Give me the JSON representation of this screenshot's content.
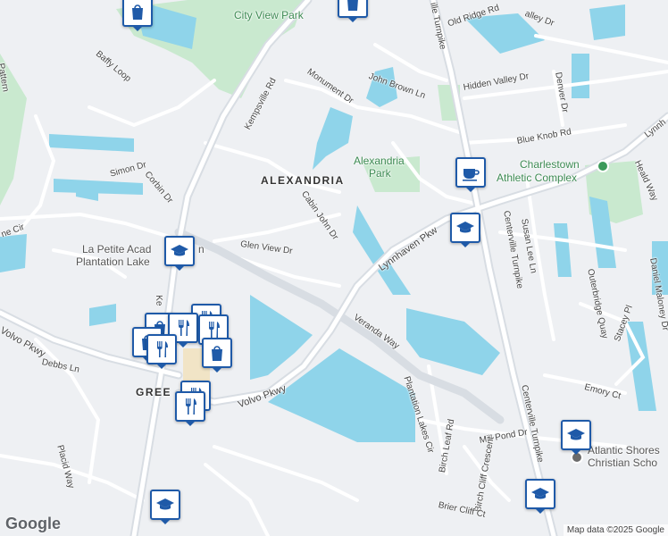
{
  "map": {
    "attribution": "Map data ©2025 Google",
    "logo": "Google"
  },
  "areas": {
    "alexandria": "ALEXANDRIA",
    "greenbriar_line1": "GREE",
    "greenbriar_line2": "EA"
  },
  "parks": {
    "city_view_park": "City View Park",
    "alexandria_park_line1": "Alexandria",
    "alexandria_park_line2": "Park"
  },
  "places": {
    "la_petite_line1": "La Petite Acad",
    "la_petite_line1b": "n",
    "la_petite_line2": "Plantation Lake",
    "charlestown_line1": "Charlestown",
    "charlestown_line2": "Athletic Complex",
    "atlantic_shores_line1": "Atlantic Shores",
    "atlantic_shores_line2": "Christian Scho"
  },
  "streets": {
    "kempsville_rd": "Kempsville Rd",
    "kempsville_partial": "Ke",
    "centerville_tpke_top": "ille Turnpike",
    "centerville_tpke_1": "Centerville Turnpike",
    "centerville_tpke_2": "Centerville Turnpike",
    "old_ridge_rd": "Old Ridge Rd",
    "valley_dr": "alley Dr",
    "john_brown_ln": "John Brown Ln",
    "hidden_valley_dr": "Hidden Valley Dr",
    "monument_dr": "Monument Dr",
    "denver_dr": "Denver Dr",
    "blue_knob_rd": "Blue Knob Rd",
    "lynnhaven_top": "Lynnh",
    "heald_way": "Heald Way",
    "baffy_loop": "Baffy Loop",
    "simon_dr": "Simon Dr",
    "corbin_dr": "Corbin Dr",
    "cabin_john_dr": "Cabin John Dr",
    "glen_view_dr": "Glen View Dr",
    "lynnhaven_pkwy": "Lynnhaven Pkw",
    "susan_lee_ln": "Susan Lee Ln",
    "daniel_maloney_dr": "Daniel Maloney Dr",
    "outerbridge_quay": "Outerbridge Quay",
    "stacey_pl": "Stacey Pl",
    "emory_ct": "Emory Ct",
    "volvo_pkwy_left": "Volvo Pkwy",
    "volvo_pkwy_mid": "Volvo Pkwy",
    "veranda_way": "Veranda Way",
    "plantation_lakes_cir": "Plantation Lakes Cir",
    "birch_leaf_rd": "Birch Leaf Rd",
    "mill_pond_dr": "Mill Pond Dr",
    "birch_cliff_crescent": "Birch Cliff Crescent",
    "brier_cliff_ct": "Brier Cliff Ct",
    "debbs_ln": "Debbs Ln",
    "placid_way": "Placid Way",
    "ne_cir": "ne Cir",
    "pattern_partial": "Pattern"
  },
  "pins": [
    {
      "name": "shopping-pin",
      "icon": "shopping-bag-icon"
    },
    {
      "name": "shopping-pin",
      "icon": "shopping-bag-icon"
    },
    {
      "name": "cafe-pin",
      "icon": "coffee-cup-icon"
    },
    {
      "name": "school-pin",
      "icon": "graduation-cap-icon"
    },
    {
      "name": "school-pin",
      "icon": "graduation-cap-icon"
    },
    {
      "name": "restaurant-pin",
      "icon": "fork-knife-icon"
    },
    {
      "name": "school-pin",
      "icon": "graduation-cap-icon"
    },
    {
      "name": "school-pin",
      "icon": "graduation-cap-icon"
    },
    {
      "name": "school-pin",
      "icon": "graduation-cap-icon"
    }
  ],
  "colors": {
    "water": "#8fd4ea",
    "park": "#c9e9cf",
    "road": "#ffffff",
    "major_road": "#d8dde3",
    "background": "#eef0f3",
    "pin_border": "#1f5aa8"
  }
}
